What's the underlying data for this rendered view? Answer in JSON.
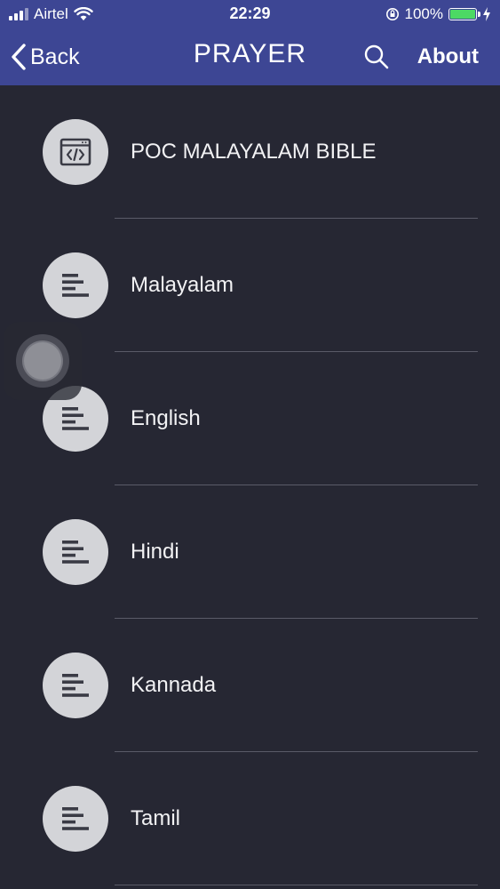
{
  "status_bar": {
    "carrier": "Airtel",
    "time": "22:29",
    "battery_percent": "100%"
  },
  "nav": {
    "back_label": "Back",
    "title": "PRAYER",
    "about_label": "About"
  },
  "list": {
    "items": [
      {
        "label": "POC MALAYALAM BIBLE",
        "icon": "code-window-icon"
      },
      {
        "label": "Malayalam",
        "icon": "align-left-icon"
      },
      {
        "label": "English",
        "icon": "align-left-icon"
      },
      {
        "label": "Hindi",
        "icon": "align-left-icon"
      },
      {
        "label": "Kannada",
        "icon": "align-left-icon"
      },
      {
        "label": "Tamil",
        "icon": "align-left-icon"
      }
    ]
  },
  "colors": {
    "header_bg": "#3d4694",
    "list_bg": "#262733",
    "icon_circle": "#d3d4d8",
    "battery_fill": "#4cd964"
  }
}
